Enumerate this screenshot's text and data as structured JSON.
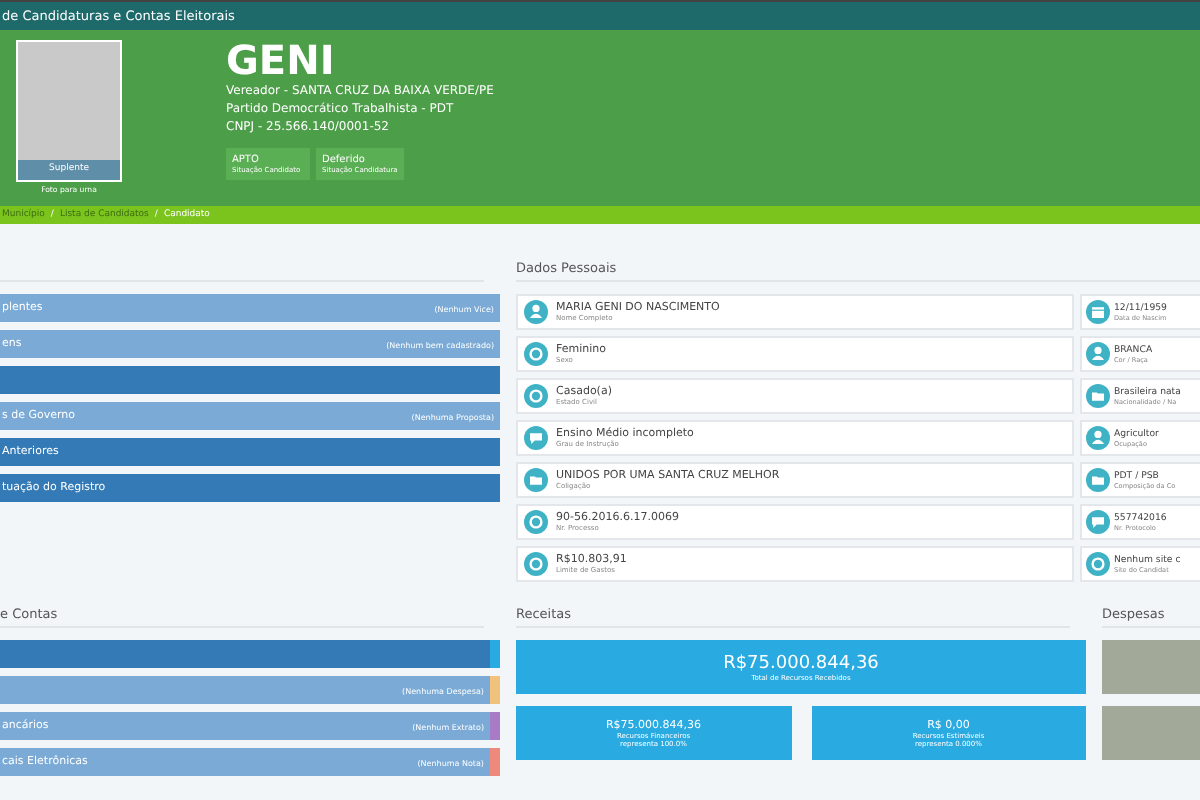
{
  "top_bar": {
    "title": "de Candidaturas e Contas Eleitorais"
  },
  "candidate": {
    "photo_tag": "Suplente",
    "photo_caption": "Foto para urna",
    "name": "GENI",
    "lines": [
      "Vereador - SANTA CRUZ DA BAIXA VERDE/PE",
      "Partido Democrático Trabalhista - PDT",
      "CNPJ - 25.566.140/0001-52"
    ],
    "badges": [
      {
        "value": "APTO",
        "label": "Situação Candidato"
      },
      {
        "value": "Deferido",
        "label": "Situação Candidatura"
      }
    ]
  },
  "breadcrumb": {
    "separator": "/",
    "items": [
      {
        "label": "Município",
        "selected": false
      },
      {
        "label": "Lista de Candidatos",
        "selected": false
      },
      {
        "label": "Candidato",
        "selected": true
      }
    ]
  },
  "candidacy_panel": {
    "items": [
      {
        "kind": "empty",
        "label": "plentes",
        "note": "(Nenhum Vice)"
      },
      {
        "kind": "empty",
        "label": "ens",
        "note": "(Nenhum bem cadastrado)"
      },
      {
        "kind": "link"
      },
      {
        "kind": "empty",
        "label": "s de Governo",
        "note": "(Nenhuma Proposta)"
      },
      {
        "kind": "link",
        "label": "Anteriores"
      },
      {
        "kind": "link",
        "label": "tuação do Registro"
      }
    ]
  },
  "personal_data": {
    "title": "Dados Pessoais",
    "left_fields": [
      {
        "value": "MARIA GENI DO NASCIMENTO",
        "label": "Nome Completo"
      },
      {
        "value": "Feminino",
        "label": "Sexo"
      },
      {
        "value": "Casado(a)",
        "label": "Estado Civil"
      },
      {
        "value": "Ensino Médio incompleto",
        "label": "Grau de Instrução"
      },
      {
        "value": "UNIDOS POR UMA SANTA CRUZ MELHOR",
        "label": "Coligação"
      },
      {
        "value": "90-56.2016.6.17.0069",
        "label": "Nr. Processo"
      },
      {
        "value": "R$10.803,91",
        "label": "Limite de Gastos"
      }
    ],
    "right_fields": [
      {
        "value": "12/11/1959",
        "label": "Data de Nascim"
      },
      {
        "value": "BRANCA",
        "label": "Cor / Raça"
      },
      {
        "value": "Brasileira nata",
        "label": "Nacionalidade / Na"
      },
      {
        "value": "Agricultor",
        "label": "Ocupação"
      },
      {
        "value": "PDT / PSB",
        "label": "Composição da Co"
      },
      {
        "value": "557742016",
        "label": "Nr. Protocolo"
      },
      {
        "value": "Nenhum site c",
        "label": "Site do Candidat"
      }
    ]
  },
  "accounts_panel": {
    "title": "e Contas",
    "items": [
      {
        "kind": "link",
        "color": "#29abe2"
      },
      {
        "kind": "empty",
        "note": "(Nenhuma Despesa)",
        "color": "#f0c27b"
      },
      {
        "kind": "empty",
        "label": "ancários",
        "note": "(Nenhum Extrato)",
        "color": "#a77bc6"
      },
      {
        "kind": "empty",
        "label": "cais Eletrônicas",
        "note": "(Nenhuma Nota)",
        "color": "#ee8a7b"
      }
    ]
  },
  "receipts": {
    "title": "Receitas",
    "total": {
      "amount": "R$75.000.844,36",
      "label": "Total de Recursos Recebidos"
    },
    "parts": [
      {
        "amount": "R$75.000.844,36",
        "label": "Recursos Financeiros",
        "share": "representa 100.0%"
      },
      {
        "amount": "R$ 0,00",
        "label": "Recursos Estimáveis",
        "share": "representa 0.000%"
      }
    ]
  },
  "expenses": {
    "title": "Despesas"
  }
}
